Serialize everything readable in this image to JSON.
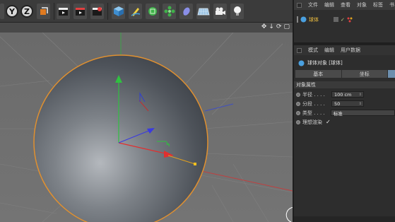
{
  "toolbar": {
    "axis_y": "Y",
    "axis_z": "Z",
    "tools": [
      "coord-system",
      "render-view",
      "render-picture",
      "render-settings",
      "cube",
      "pen",
      "subdivision",
      "cloner",
      "deformer",
      "floor",
      "camera",
      "light"
    ]
  },
  "viewport": {
    "nav_icons": [
      "✥",
      "↓",
      "⟳",
      "▢"
    ]
  },
  "object_manager": {
    "menu": [
      "文件",
      "编辑",
      "查看",
      "对象",
      "标签",
      "书"
    ],
    "object_name": "球体"
  },
  "attributes": {
    "menu": [
      "模式",
      "编辑",
      "用户数据"
    ],
    "title": "球体对象 [球体]",
    "tabs": [
      "基本",
      "坐标",
      ""
    ],
    "section": "对象属性",
    "props": [
      {
        "label": "半径 . . . .",
        "value": "100 cm"
      },
      {
        "label": "分段 . . . .",
        "value": "50"
      },
      {
        "label": "类型 . . . .",
        "value": "标准"
      },
      {
        "label": "理想渲染",
        "value": "✓"
      }
    ]
  },
  "colors": {
    "accent": "#6d8fae",
    "sphere_outline": "#e09030",
    "viewport_bg": "#6c6c6c"
  }
}
